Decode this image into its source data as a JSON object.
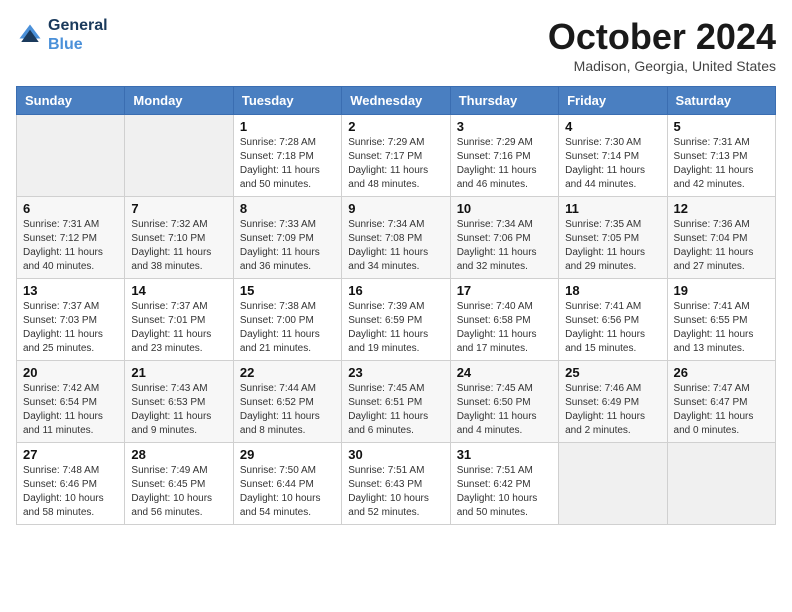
{
  "header": {
    "logo_line1": "General",
    "logo_line2": "Blue",
    "month": "October 2024",
    "location": "Madison, Georgia, United States"
  },
  "weekdays": [
    "Sunday",
    "Monday",
    "Tuesday",
    "Wednesday",
    "Thursday",
    "Friday",
    "Saturday"
  ],
  "weeks": [
    [
      {
        "day": "",
        "sunrise": "",
        "sunset": "",
        "daylight": ""
      },
      {
        "day": "",
        "sunrise": "",
        "sunset": "",
        "daylight": ""
      },
      {
        "day": "1",
        "sunrise": "Sunrise: 7:28 AM",
        "sunset": "Sunset: 7:18 PM",
        "daylight": "Daylight: 11 hours and 50 minutes."
      },
      {
        "day": "2",
        "sunrise": "Sunrise: 7:29 AM",
        "sunset": "Sunset: 7:17 PM",
        "daylight": "Daylight: 11 hours and 48 minutes."
      },
      {
        "day": "3",
        "sunrise": "Sunrise: 7:29 AM",
        "sunset": "Sunset: 7:16 PM",
        "daylight": "Daylight: 11 hours and 46 minutes."
      },
      {
        "day": "4",
        "sunrise": "Sunrise: 7:30 AM",
        "sunset": "Sunset: 7:14 PM",
        "daylight": "Daylight: 11 hours and 44 minutes."
      },
      {
        "day": "5",
        "sunrise": "Sunrise: 7:31 AM",
        "sunset": "Sunset: 7:13 PM",
        "daylight": "Daylight: 11 hours and 42 minutes."
      }
    ],
    [
      {
        "day": "6",
        "sunrise": "Sunrise: 7:31 AM",
        "sunset": "Sunset: 7:12 PM",
        "daylight": "Daylight: 11 hours and 40 minutes."
      },
      {
        "day": "7",
        "sunrise": "Sunrise: 7:32 AM",
        "sunset": "Sunset: 7:10 PM",
        "daylight": "Daylight: 11 hours and 38 minutes."
      },
      {
        "day": "8",
        "sunrise": "Sunrise: 7:33 AM",
        "sunset": "Sunset: 7:09 PM",
        "daylight": "Daylight: 11 hours and 36 minutes."
      },
      {
        "day": "9",
        "sunrise": "Sunrise: 7:34 AM",
        "sunset": "Sunset: 7:08 PM",
        "daylight": "Daylight: 11 hours and 34 minutes."
      },
      {
        "day": "10",
        "sunrise": "Sunrise: 7:34 AM",
        "sunset": "Sunset: 7:06 PM",
        "daylight": "Daylight: 11 hours and 32 minutes."
      },
      {
        "day": "11",
        "sunrise": "Sunrise: 7:35 AM",
        "sunset": "Sunset: 7:05 PM",
        "daylight": "Daylight: 11 hours and 29 minutes."
      },
      {
        "day": "12",
        "sunrise": "Sunrise: 7:36 AM",
        "sunset": "Sunset: 7:04 PM",
        "daylight": "Daylight: 11 hours and 27 minutes."
      }
    ],
    [
      {
        "day": "13",
        "sunrise": "Sunrise: 7:37 AM",
        "sunset": "Sunset: 7:03 PM",
        "daylight": "Daylight: 11 hours and 25 minutes."
      },
      {
        "day": "14",
        "sunrise": "Sunrise: 7:37 AM",
        "sunset": "Sunset: 7:01 PM",
        "daylight": "Daylight: 11 hours and 23 minutes."
      },
      {
        "day": "15",
        "sunrise": "Sunrise: 7:38 AM",
        "sunset": "Sunset: 7:00 PM",
        "daylight": "Daylight: 11 hours and 21 minutes."
      },
      {
        "day": "16",
        "sunrise": "Sunrise: 7:39 AM",
        "sunset": "Sunset: 6:59 PM",
        "daylight": "Daylight: 11 hours and 19 minutes."
      },
      {
        "day": "17",
        "sunrise": "Sunrise: 7:40 AM",
        "sunset": "Sunset: 6:58 PM",
        "daylight": "Daylight: 11 hours and 17 minutes."
      },
      {
        "day": "18",
        "sunrise": "Sunrise: 7:41 AM",
        "sunset": "Sunset: 6:56 PM",
        "daylight": "Daylight: 11 hours and 15 minutes."
      },
      {
        "day": "19",
        "sunrise": "Sunrise: 7:41 AM",
        "sunset": "Sunset: 6:55 PM",
        "daylight": "Daylight: 11 hours and 13 minutes."
      }
    ],
    [
      {
        "day": "20",
        "sunrise": "Sunrise: 7:42 AM",
        "sunset": "Sunset: 6:54 PM",
        "daylight": "Daylight: 11 hours and 11 minutes."
      },
      {
        "day": "21",
        "sunrise": "Sunrise: 7:43 AM",
        "sunset": "Sunset: 6:53 PM",
        "daylight": "Daylight: 11 hours and 9 minutes."
      },
      {
        "day": "22",
        "sunrise": "Sunrise: 7:44 AM",
        "sunset": "Sunset: 6:52 PM",
        "daylight": "Daylight: 11 hours and 8 minutes."
      },
      {
        "day": "23",
        "sunrise": "Sunrise: 7:45 AM",
        "sunset": "Sunset: 6:51 PM",
        "daylight": "Daylight: 11 hours and 6 minutes."
      },
      {
        "day": "24",
        "sunrise": "Sunrise: 7:45 AM",
        "sunset": "Sunset: 6:50 PM",
        "daylight": "Daylight: 11 hours and 4 minutes."
      },
      {
        "day": "25",
        "sunrise": "Sunrise: 7:46 AM",
        "sunset": "Sunset: 6:49 PM",
        "daylight": "Daylight: 11 hours and 2 minutes."
      },
      {
        "day": "26",
        "sunrise": "Sunrise: 7:47 AM",
        "sunset": "Sunset: 6:47 PM",
        "daylight": "Daylight: 11 hours and 0 minutes."
      }
    ],
    [
      {
        "day": "27",
        "sunrise": "Sunrise: 7:48 AM",
        "sunset": "Sunset: 6:46 PM",
        "daylight": "Daylight: 10 hours and 58 minutes."
      },
      {
        "day": "28",
        "sunrise": "Sunrise: 7:49 AM",
        "sunset": "Sunset: 6:45 PM",
        "daylight": "Daylight: 10 hours and 56 minutes."
      },
      {
        "day": "29",
        "sunrise": "Sunrise: 7:50 AM",
        "sunset": "Sunset: 6:44 PM",
        "daylight": "Daylight: 10 hours and 54 minutes."
      },
      {
        "day": "30",
        "sunrise": "Sunrise: 7:51 AM",
        "sunset": "Sunset: 6:43 PM",
        "daylight": "Daylight: 10 hours and 52 minutes."
      },
      {
        "day": "31",
        "sunrise": "Sunrise: 7:51 AM",
        "sunset": "Sunset: 6:42 PM",
        "daylight": "Daylight: 10 hours and 50 minutes."
      },
      {
        "day": "",
        "sunrise": "",
        "sunset": "",
        "daylight": ""
      },
      {
        "day": "",
        "sunrise": "",
        "sunset": "",
        "daylight": ""
      }
    ]
  ]
}
